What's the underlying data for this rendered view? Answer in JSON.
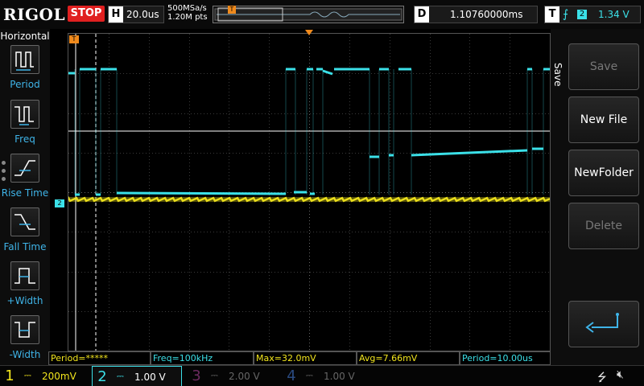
{
  "top": {
    "brand": "RIGOL",
    "run_state": "STOP",
    "horiz_key": "H",
    "timebase": "20.0us",
    "sample_rate": "500MSa/s",
    "memory_depth": "1.20M pts",
    "trigger_flag": "T",
    "delay_key": "D",
    "delay_value": "1.10760000ms",
    "trigger_key": "T",
    "trigger_edge": "⨍",
    "trigger_source": "2",
    "trigger_level": "1.34 V"
  },
  "left_menu": {
    "title": "Horizontal",
    "items": [
      {
        "label": "Period",
        "icon": "period-icon"
      },
      {
        "label": "Freq",
        "icon": "freq-icon"
      },
      {
        "label": "Rise Time",
        "icon": "rise-time-icon"
      },
      {
        "label": "Fall Time",
        "icon": "fall-time-icon"
      },
      {
        "label": "+Width",
        "icon": "positive-width-icon"
      },
      {
        "label": "-Width",
        "icon": "negative-width-icon"
      }
    ]
  },
  "markers": {
    "trigger_time": "T",
    "ch2_ground": "2",
    "trigger_level": "T"
  },
  "measurements": {
    "period1": "Period=*****",
    "freq": "Freq=100kHz",
    "max": "Max=32.0mV",
    "avg": "Avg=7.66mV",
    "period2": "Period=10.00us"
  },
  "right_menu": {
    "tab": "Save",
    "buttons": [
      {
        "label": "Save",
        "enabled": false
      },
      {
        "label": "New File",
        "enabled": true
      },
      {
        "label": "NewFolder",
        "enabled": true
      },
      {
        "label": "Delete",
        "enabled": false
      }
    ],
    "back_icon": "return-arrow-icon"
  },
  "channels": [
    {
      "num": "1",
      "coupling": "⎓",
      "scale": "200mV",
      "color": "#f2e51d"
    },
    {
      "num": "2",
      "coupling": "⎓",
      "scale": "1.00 V",
      "color": "#3be0e8"
    },
    {
      "num": "3",
      "coupling": "⎓",
      "scale": "2.00 V",
      "color": "#b0309a"
    },
    {
      "num": "4",
      "coupling": "⎓",
      "scale": "1.00 V",
      "color": "#2f6fd8"
    }
  ],
  "status_icons": [
    "usb-icon",
    "speaker-muted-icon"
  ],
  "colors": {
    "ch1": "#f2e51d",
    "ch2": "#3be0e8",
    "stop": "#e02020",
    "orange_marker": "#f08a1c",
    "menu_label": "#3fb4e8"
  }
}
